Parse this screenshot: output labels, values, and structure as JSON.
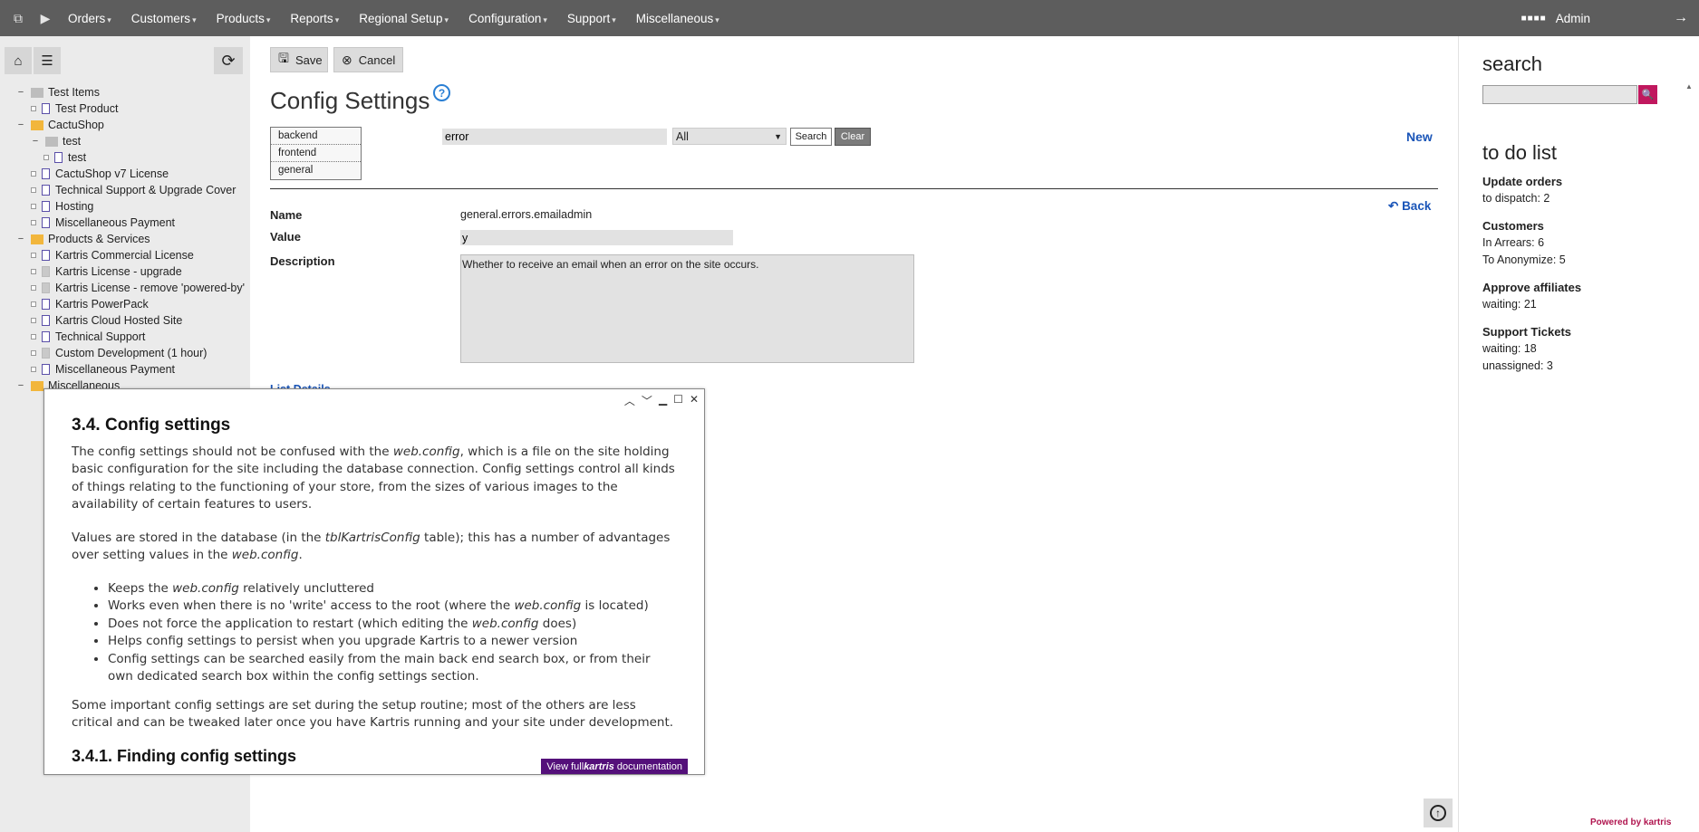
{
  "topbar": {
    "menu": [
      {
        "label": "Orders"
      },
      {
        "label": "Customers"
      },
      {
        "label": "Products"
      },
      {
        "label": "Reports"
      },
      {
        "label": "Regional Setup"
      },
      {
        "label": "Configuration"
      },
      {
        "label": "Support"
      },
      {
        "label": "Miscellaneous"
      }
    ],
    "user": "Admin"
  },
  "tree": [
    {
      "label": "Test Items"
    },
    {
      "label": "Test Product"
    },
    {
      "label": "CactuShop"
    },
    {
      "label": "test"
    },
    {
      "label": "test"
    },
    {
      "label": "CactuShop v7 License"
    },
    {
      "label": "Technical Support & Upgrade Cover"
    },
    {
      "label": "Hosting"
    },
    {
      "label": "Miscellaneous Payment"
    },
    {
      "label": "Products & Services"
    },
    {
      "label": "Kartris Commercial License"
    },
    {
      "label": "Kartris License - upgrade"
    },
    {
      "label": "Kartris License - remove 'powered-by'"
    },
    {
      "label": "Kartris PowerPack"
    },
    {
      "label": "Kartris Cloud Hosted Site"
    },
    {
      "label": "Technical Support"
    },
    {
      "label": "Custom Development (1 hour)"
    },
    {
      "label": "Miscellaneous Payment"
    },
    {
      "label": "Miscellaneous"
    }
  ],
  "toolbar": {
    "save_label": "Save",
    "cancel_label": "Cancel"
  },
  "page_title": "Config Settings",
  "categories": [
    "backend",
    "frontend",
    "general"
  ],
  "search": {
    "value": "error",
    "filter": "All",
    "search_label": "Search",
    "clear_label": "Clear"
  },
  "new_label": "New",
  "back_label": "Back",
  "form": {
    "name_label": "Name",
    "name_value": "general.errors.emailadmin",
    "value_label": "Value",
    "value_value": "y",
    "description_label": "Description",
    "description_value": "Whether to receive an email when an error on the site occurs."
  },
  "list_details": "List Details",
  "right": {
    "search_heading": "search",
    "todo_heading": "to do list",
    "sections": [
      {
        "title": "Update orders",
        "lines": [
          "to dispatch:  2"
        ]
      },
      {
        "title": "Customers",
        "lines": [
          "In Arrears:  6",
          "To Anonymize:  5"
        ]
      },
      {
        "title": "Approve affiliates",
        "lines": [
          "waiting:  21"
        ]
      },
      {
        "title": "Support Tickets",
        "lines": [
          "waiting: 18",
          "unassigned:  3"
        ]
      }
    ],
    "powered_by": "Powered by kartris"
  },
  "help": {
    "heading": "3.4.  Config settings",
    "p1": [
      "The config settings should not be confused with the ",
      "web.config",
      ", which is a file on the site holding basic configuration for the site including the database connection. Config settings control all kinds of things relating to the functioning of your store, from the sizes of various images to the availability of certain features to users."
    ],
    "p2": [
      "Values are stored in the database (in the ",
      "tblKartrisConfig",
      " table); this has a number of advantages over setting values in the ",
      "web.config",
      "."
    ],
    "bullets": [
      [
        "Keeps the ",
        "web.config",
        " relatively uncluttered"
      ],
      [
        "Works even when there is no 'write' access to the root (where the ",
        "web.config",
        " is located)"
      ],
      [
        "Does not force the application to restart (which editing the ",
        "web.config",
        " does)"
      ],
      [
        "Helps config settings to persist when you upgrade Kartris to a newer version"
      ],
      [
        "Config settings can be searched easily from the main back end search box, or from their own dedicated search box within the config settings section."
      ]
    ],
    "p3": "Some important config settings are set during the setup routine; most of the others are less critical and can be tweaked later once you have Kartris running and your site under development.",
    "subheading": "3.4.1.  Finding config settings",
    "docs_button": [
      "View full ",
      "kartris",
      " documentation"
    ]
  },
  "colors": {
    "topbar": "#5d5d5d",
    "accent_link": "#1a55b8",
    "brand_magenta": "#c0185e",
    "docs_purple": "#54107a"
  },
  "icons": [
    "popout-icon",
    "play-icon",
    "home-icon",
    "list-icon",
    "refresh-icon",
    "save-icon",
    "cancel-icon",
    "help-icon",
    "back-arrow-icon",
    "search-icon",
    "logout-icon",
    "scroll-top-icon"
  ]
}
